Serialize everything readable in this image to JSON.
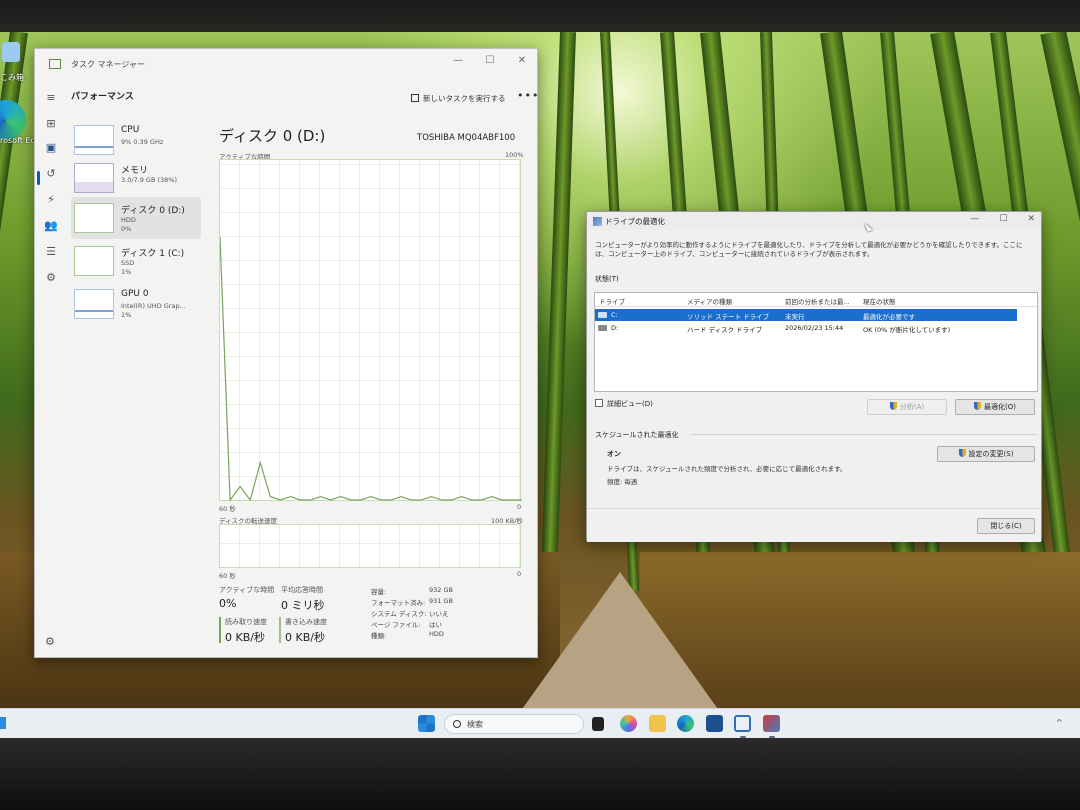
{
  "desktop": {
    "labels": [
      "こみ箱",
      "rosoft Edg"
    ]
  },
  "task_manager": {
    "title": "タスク マネージャー",
    "section_title": "パフォーマンス",
    "new_task_label": "新しいタスクを実行する",
    "more_label": "•••",
    "perf_items": [
      {
        "name": "CPU",
        "line1": "9% 0.39 GHz",
        "line2": ""
      },
      {
        "name": "メモリ",
        "line1": "3.0/7.9 GB (38%)",
        "line2": ""
      },
      {
        "name": "ディスク 0 (D:)",
        "line1": "HDD",
        "line2": "0%"
      },
      {
        "name": "ディスク 1 (C:)",
        "line1": "SSD",
        "line2": "1%"
      },
      {
        "name": "GPU 0",
        "line1": "Intel(R) UHD Grap...",
        "line2": "1%"
      }
    ],
    "disk": {
      "title": "ディスク 0 (D:)",
      "model": "TOSHIBA MQ04ABF100",
      "graph1_label": "アクティブな時間",
      "graph1_max": "100%",
      "graph1_xlabel": "60 秒",
      "graph1_min": "0",
      "graph2_label": "ディスクの転送速度",
      "graph2_max": "100 KB/秒",
      "graph2_xlabel": "60 秒",
      "graph2_min": "0",
      "activity_samples": [
        0.78,
        0.0,
        0.04,
        0.0,
        0.11,
        0.01,
        0.0,
        0.01,
        0.0,
        0.0,
        0.01,
        0.0,
        0.01,
        0.0,
        0.0,
        0.01,
        0.0,
        0.0,
        0.01,
        0.0,
        0.0,
        0.01,
        0.0,
        0.0,
        0.01,
        0.0,
        0.0,
        0.01,
        0.0,
        0.0,
        0.0
      ],
      "stats": {
        "active_time_label": "アクティブな時間",
        "active_time_value": "0%",
        "avg_response_label": "平均応答時間",
        "avg_response_value": "0 ミリ秒",
        "read_speed_label": "読み取り速度",
        "read_speed_value": "0 KB/秒",
        "write_speed_label": "書き込み速度",
        "write_speed_value": "0 KB/秒"
      },
      "properties": [
        {
          "key": "容量:",
          "value": "932 GB"
        },
        {
          "key": "フォーマット済み:",
          "value": "931 GB"
        },
        {
          "key": "システム ディスク:",
          "value": "いいえ"
        },
        {
          "key": "ページ ファイル:",
          "value": "はい"
        },
        {
          "key": "種類:",
          "value": "HDD"
        }
      ]
    }
  },
  "defrag_dialog": {
    "title": "ドライブの最適化",
    "description": "コンピューターがより効率的に動作するようにドライブを最適化したり、ドライブを分析して最適化が必要かどうかを確認したりできます。ここには、コンピューター上のドライブ、コンピューターに接続されているドライブが表示されます。",
    "status_label": "状態(T)",
    "columns": [
      "ドライブ",
      "メディアの種類",
      "前回の分析または最...",
      "現在の状態"
    ],
    "drives": [
      {
        "drive": "C:",
        "media": "ソリッド ステート ドライブ",
        "last": "未実行",
        "status": "最適化が必要です",
        "selected": true
      },
      {
        "drive": "D:",
        "media": "ハード ディスク ドライブ",
        "last": "2026/02/23 15:44",
        "status": "OK (0% が断片化しています)",
        "selected": false
      }
    ],
    "detail_view_label": "詳細ビュー(D)",
    "analyze_button": "分析(A)",
    "optimize_button": "最適化(O)",
    "scheduled_header": "スケジュールされた最適化",
    "scheduled_state": "オン",
    "scheduled_desc": "ドライブは、スケジュールされた頻度で分析され、必要に応じて最適化されます。",
    "frequency": "頻度: 毎週",
    "change_settings_button": "設定の変更(S)",
    "close_button": "閉じる(C)"
  },
  "taskbar": {
    "search_placeholder": "検索"
  }
}
